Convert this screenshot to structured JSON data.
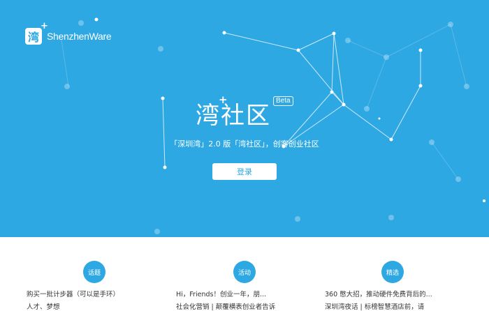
{
  "brand": {
    "logo_glyph": "湾",
    "logo_plus": "+",
    "name": "ShenzhenWare"
  },
  "hero": {
    "title": "湾社区",
    "title_plus": "+",
    "beta": "Beta",
    "subtitle": "「深圳湾」2.0 版「湾社区」，创客创业社区",
    "login_label": "登录",
    "background_color": "#2ea8e3"
  },
  "sections": [
    {
      "badge": "话题",
      "items": [
        "购买一批计步器（可以是手环）",
        "人才、梦想"
      ]
    },
    {
      "badge": "活动",
      "items": [
        "Hi，Friends！创业一年，朋...",
        "社会化营销 | 颠覆横表创业者告诉"
      ]
    },
    {
      "badge": "精选",
      "items": [
        "360 憋大招，推动硬件免费背后的...",
        "深圳湾夜话 | 标榜智慧酒店前，请"
      ]
    }
  ]
}
